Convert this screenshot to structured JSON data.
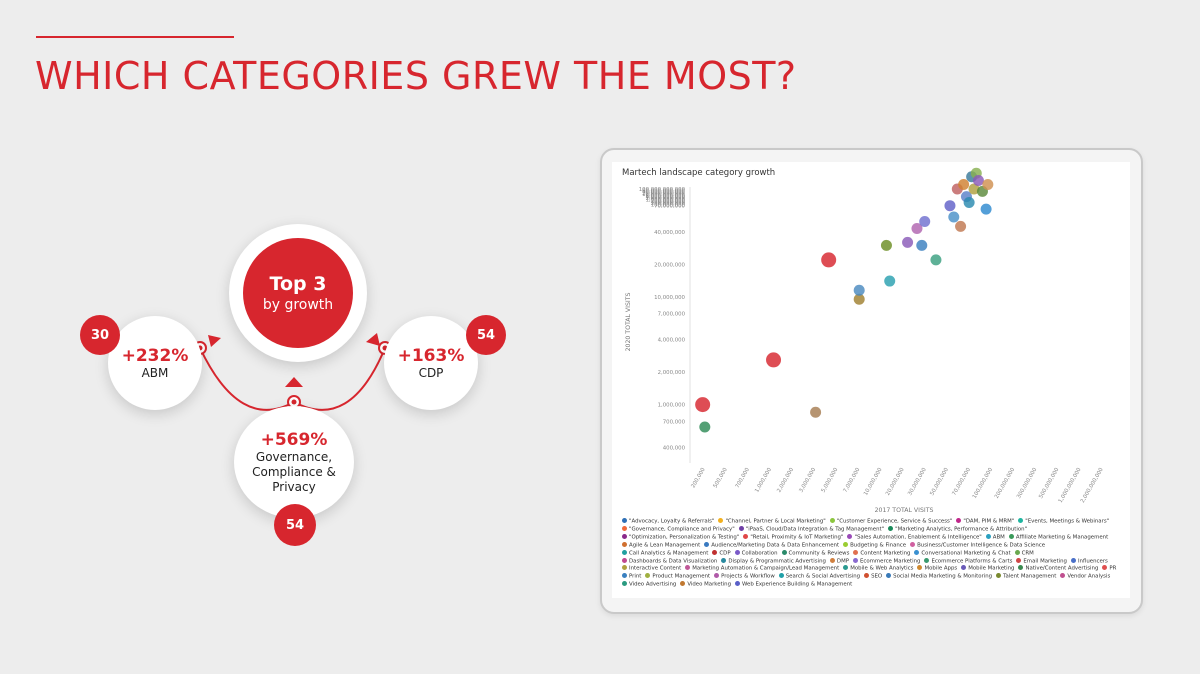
{
  "slide": {
    "title": "WHICH CATEGORIES GREW THE MOST?"
  },
  "center": {
    "line1": "Top 3",
    "line2": "by growth"
  },
  "abm": {
    "pct": "+232%",
    "label": "ABM",
    "count": "30"
  },
  "cdp": {
    "pct": "+163%",
    "label": "CDP",
    "count": "54"
  },
  "gov": {
    "pct": "+569%",
    "label_line1": "Governance,",
    "label_line2": "Compliance & Privacy",
    "count": "54"
  },
  "colors": {
    "accent": "#d7262e"
  },
  "chart_data": {
    "type": "scatter",
    "title": "Martech landscape category growth",
    "xlabel": "2017 TOTAL VISITS",
    "ylabel": "2020 TOTAL VISITS",
    "x_scale": "log",
    "y_scale": "log",
    "xlim": [
      150000,
      2500000000
    ],
    "ylim": [
      300000,
      100000000
    ],
    "x_ticks": [
      {
        "v": 200000,
        "label": "200,000"
      },
      {
        "v": 500000,
        "label": "500,000"
      },
      {
        "v": 700000,
        "label": "700,000"
      },
      {
        "v": 1000000,
        "label": "1,000,000"
      },
      {
        "v": 2000000,
        "label": "2,000,000"
      },
      {
        "v": 3000000,
        "label": "3,000,000"
      },
      {
        "v": 5000000,
        "label": "5,000,000"
      },
      {
        "v": 7000000,
        "label": "7,000,000"
      },
      {
        "v": 10000000,
        "label": "10,000,000"
      },
      {
        "v": 20000000,
        "label": "20,000,000"
      },
      {
        "v": 30000000,
        "label": "30,000,000"
      },
      {
        "v": 50000000,
        "label": "50,000,000"
      },
      {
        "v": 70000000,
        "label": "70,000,000"
      },
      {
        "v": 100000000,
        "label": "100,000,000"
      },
      {
        "v": 200000000,
        "label": "200,000,000"
      },
      {
        "v": 300000000,
        "label": "300,000,000"
      },
      {
        "v": 500000000,
        "label": "500,000,000"
      },
      {
        "v": 1000000000,
        "label": "1,000,000,000"
      },
      {
        "v": 2000000000,
        "label": "2,000,000,000"
      }
    ],
    "y_ticks": [
      {
        "v": 400000,
        "label": "400,000"
      },
      {
        "v": 700000,
        "label": "700,000"
      },
      {
        "v": 1000000,
        "label": "1,000,000"
      },
      {
        "v": 2000000,
        "label": "2,000,000"
      },
      {
        "v": 4000000,
        "label": "4,000,000"
      },
      {
        "v": 7000000,
        "label": "7,000,000"
      },
      {
        "v": 10000000,
        "label": "10,000,000"
      },
      {
        "v": 20000000,
        "label": "20,000,000"
      },
      {
        "v": 40000000,
        "label": "40,000,000"
      },
      {
        "v": 70000000,
        "label": "70,000,000"
      },
      {
        "v": 100000000,
        "label": "100,000,000"
      },
      {
        "v": 200000000,
        "label": "200,000,000"
      },
      {
        "v": 400000000,
        "label": "400,000,000"
      },
      {
        "v": 700000000,
        "label": "700,000,000"
      },
      {
        "v": 1000000000,
        "label": "1,000,000,000"
      },
      {
        "v": 2000000000,
        "label": "2,000,000,000"
      },
      {
        "v": 4000000000,
        "label": "4,000,000,000"
      },
      {
        "v": 6000000000,
        "label": "6,000,000,000"
      },
      {
        "v": 10000000000,
        "label": "10,000,000,000"
      },
      {
        "v": 20000000000,
        "label": "20,000,000,000"
      },
      {
        "v": 40000000000,
        "label": "40,000,000,000"
      },
      {
        "v": 60000000000,
        "label": "60,000,000,000"
      },
      {
        "v": 100000000000,
        "label": "100,000,000,000"
      }
    ],
    "points": [
      {
        "x": 200000,
        "y": 1000000,
        "color": "#d7262e",
        "big": true
      },
      {
        "x": 210000,
        "y": 620000,
        "color": "#2e8b57"
      },
      {
        "x": 1000000,
        "y": 2600000,
        "color": "#d7262e",
        "big": true
      },
      {
        "x": 2600000,
        "y": 850000,
        "color": "#a67c52"
      },
      {
        "x": 3500000,
        "y": 22000000,
        "color": "#d7262e",
        "big": true
      },
      {
        "x": 7000000,
        "y": 9500000,
        "color": "#a08030"
      },
      {
        "x": 7000000,
        "y": 11500000,
        "color": "#4a8ac0"
      },
      {
        "x": 13000000,
        "y": 30000000,
        "color": "#6b8e23"
      },
      {
        "x": 14000000,
        "y": 14000000,
        "color": "#2aa0b0"
      },
      {
        "x": 21000000,
        "y": 32000000,
        "color": "#8a5ab8"
      },
      {
        "x": 26000000,
        "y": 43000000,
        "color": "#b064b0"
      },
      {
        "x": 29000000,
        "y": 30000000,
        "color": "#3a80c0"
      },
      {
        "x": 31000000,
        "y": 50000000,
        "color": "#7070d0"
      },
      {
        "x": 40000000,
        "y": 22000000,
        "color": "#3aa080"
      },
      {
        "x": 55000000,
        "y": 70000000,
        "color": "#6060c8"
      },
      {
        "x": 60000000,
        "y": 55000000,
        "color": "#4a90c8"
      },
      {
        "x": 65000000,
        "y": 100000000,
        "color": "#c06060"
      },
      {
        "x": 70000000,
        "y": 45000000,
        "color": "#c07850"
      },
      {
        "x": 75000000,
        "y": 110000000,
        "color": "#d08030"
      },
      {
        "x": 80000000,
        "y": 85000000,
        "color": "#5a80c8"
      },
      {
        "x": 85000000,
        "y": 75000000,
        "color": "#2a8ab0"
      },
      {
        "x": 90000000,
        "y": 130000000,
        "color": "#3a7a9a"
      },
      {
        "x": 95000000,
        "y": 100000000,
        "color": "#b0a040"
      },
      {
        "x": 100000000,
        "y": 140000000,
        "color": "#88b050"
      },
      {
        "x": 105000000,
        "y": 120000000,
        "color": "#8a5ab8"
      },
      {
        "x": 115000000,
        "y": 95000000,
        "color": "#5c8a3c"
      },
      {
        "x": 125000000,
        "y": 65000000,
        "color": "#2e8ad0"
      },
      {
        "x": 130000000,
        "y": 110000000,
        "color": "#d09050"
      },
      {
        "x": 160000000,
        "y": 200000000,
        "color": "#f0c040"
      },
      {
        "x": 240000000,
        "y": 260000000,
        "color": "#e07070"
      },
      {
        "x": 480000000,
        "y": 900000000,
        "color": "#d98060"
      },
      {
        "x": 850000000,
        "y": 1200000000,
        "color": "#3aa060"
      },
      {
        "x": 960000000,
        "y": 1500000000,
        "color": "#a070c0"
      },
      {
        "x": 1000000000,
        "y": 1200000000,
        "color": "#e06868"
      },
      {
        "x": 1100000000,
        "y": 600000000,
        "color": "#7080d0"
      },
      {
        "x": 1350000000,
        "y": 1150000000,
        "color": "#1a8a7a"
      }
    ],
    "legend": [
      {
        "label": "\"Advocacy, Loyalty & Referrals\"",
        "color": "#2e6fb5"
      },
      {
        "label": "\"Channel, Partner & Local Marketing\"",
        "color": "#f2b01e"
      },
      {
        "label": "\"Customer Experience, Service & Success\"",
        "color": "#8cc63f"
      },
      {
        "label": "\"DAM, PIM & MRM\"",
        "color": "#c0268a"
      },
      {
        "label": "\"Events, Meetings & Webinars\"",
        "color": "#1fb5a0"
      },
      {
        "label": "\"Governance, Compliance and Privacy\"",
        "color": "#f06a3a"
      },
      {
        "label": "\"iPaaS, Cloud/Data Integration & Tag Management\"",
        "color": "#6f3fa6"
      },
      {
        "label": "\"Marketing Analytics, Performance & Attribution\"",
        "color": "#1a8a5a"
      },
      {
        "label": "\"Optimization, Personalization & Testing\"",
        "color": "#8a2a8a"
      },
      {
        "label": "\"Retail, Proximity & IoT Marketing\"",
        "color": "#e04848"
      },
      {
        "label": "\"Sales Automation, Enablement & Intelligence\"",
        "color": "#9a4ab8"
      },
      {
        "label": "ABM",
        "color": "#2aa0c0"
      },
      {
        "label": "Affiliate Marketing & Management",
        "color": "#3a9a5a"
      },
      {
        "label": "Agile & Lean Management",
        "color": "#d07030"
      },
      {
        "label": "Audience/Marketing Data & Data Enhancement",
        "color": "#3a7ac0"
      },
      {
        "label": "Budgeting & Finance",
        "color": "#9acd32"
      },
      {
        "label": "Business/Customer Intelligence & Data Science",
        "color": "#d060a0"
      },
      {
        "label": "Call Analytics & Management",
        "color": "#20a0a0"
      },
      {
        "label": "CDP",
        "color": "#c03030"
      },
      {
        "label": "Collaboration",
        "color": "#7a5ac8"
      },
      {
        "label": "Community & Reviews",
        "color": "#2a8a6a"
      },
      {
        "label": "Content Marketing",
        "color": "#e07050"
      },
      {
        "label": "Conversational Marketing & Chat",
        "color": "#3a90d0"
      },
      {
        "label": "CRM",
        "color": "#6aa84f"
      },
      {
        "label": "Dashboards & Data Visualization",
        "color": "#c04890"
      },
      {
        "label": "Display & Programmatic Advertising",
        "color": "#2a8aa0"
      },
      {
        "label": "DMP",
        "color": "#d08040"
      },
      {
        "label": "Ecommerce Marketing",
        "color": "#8a6ad0"
      },
      {
        "label": "Ecommerce Platforms & Carts",
        "color": "#3a9a70"
      },
      {
        "label": "Email Marketing",
        "color": "#d04848"
      },
      {
        "label": "Influencers",
        "color": "#4a70c8"
      },
      {
        "label": "Interactive Content",
        "color": "#b0a040"
      },
      {
        "label": "Marketing Automation & Campaign/Lead Management",
        "color": "#c05898"
      },
      {
        "label": "Mobile & Web Analytics",
        "color": "#2a9a90"
      },
      {
        "label": "Mobile Apps",
        "color": "#d08a30"
      },
      {
        "label": "Mobile Marketing",
        "color": "#6a5ab8"
      },
      {
        "label": "Native/Content Advertising",
        "color": "#3a8a50"
      },
      {
        "label": "PR",
        "color": "#e05050"
      },
      {
        "label": "Print",
        "color": "#3a80c0"
      },
      {
        "label": "Product Management",
        "color": "#a0b040"
      },
      {
        "label": "Projects & Workflow",
        "color": "#b05aa8"
      },
      {
        "label": "Search & Social Advertising",
        "color": "#20a0a8"
      },
      {
        "label": "SEO",
        "color": "#d05030"
      },
      {
        "label": "Social Media Marketing & Monitoring",
        "color": "#3a7ab8"
      },
      {
        "label": "Talent Management",
        "color": "#7a8a30"
      },
      {
        "label": "Vendor Analysis",
        "color": "#c05090"
      },
      {
        "label": "Video Advertising",
        "color": "#2a9a80"
      },
      {
        "label": "Video Marketing",
        "color": "#c07830"
      },
      {
        "label": "Web Experience Building & Management",
        "color": "#5a60c8"
      }
    ]
  }
}
